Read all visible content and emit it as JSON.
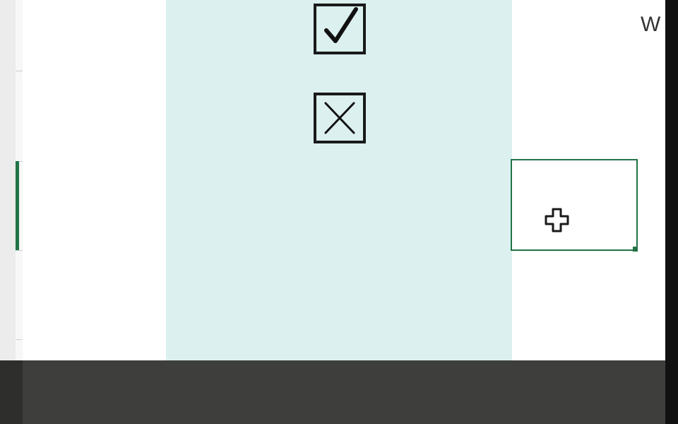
{
  "sheet": {
    "header_fragment": "W",
    "column_highlight_color": "#dbf0ef",
    "accent_color": "#217346",
    "symbols": [
      {
        "icon": "checked-box-icon",
        "meaning": "check"
      },
      {
        "icon": "crossed-box-icon",
        "meaning": "cross"
      }
    ],
    "selected_cell": {
      "value": ""
    },
    "cursor_icon": "cell-select-cursor-icon"
  },
  "status_bar": {
    "background": "#3e3f3c",
    "text": ""
  }
}
